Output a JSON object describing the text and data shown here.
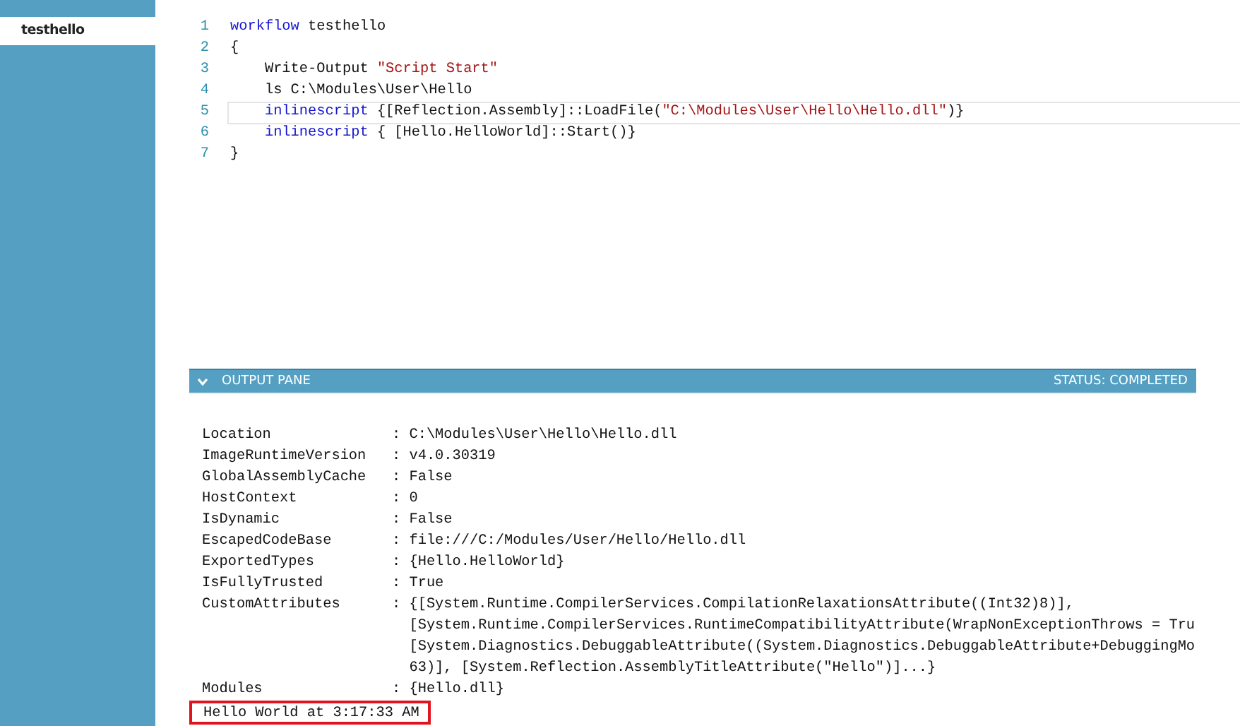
{
  "sidebar": {
    "items": [
      {
        "label": "testhello",
        "selected": true
      }
    ]
  },
  "editor": {
    "lines": [
      {
        "number": "1",
        "indented": false,
        "current": false,
        "tokens": [
          {
            "kind": "keyword",
            "text": "workflow"
          },
          {
            "kind": "plain",
            "text": " testhello"
          }
        ]
      },
      {
        "number": "2",
        "indented": false,
        "current": false,
        "tokens": [
          {
            "kind": "plain",
            "text": "{"
          }
        ]
      },
      {
        "number": "3",
        "indented": true,
        "current": false,
        "tokens": [
          {
            "kind": "plain",
            "text": "Write-Output "
          },
          {
            "kind": "string",
            "text": "\"Script Start\""
          }
        ]
      },
      {
        "number": "4",
        "indented": true,
        "current": false,
        "tokens": [
          {
            "kind": "plain",
            "text": "ls C:\\Modules\\User\\Hello"
          }
        ]
      },
      {
        "number": "5",
        "indented": true,
        "current": true,
        "tokens": [
          {
            "kind": "keyword",
            "text": "inlinescript"
          },
          {
            "kind": "plain",
            "text": " {[Reflection.Assembly]::LoadFile("
          },
          {
            "kind": "string",
            "text": "\"C:\\Modules\\User\\Hello\\Hello.dll\""
          },
          {
            "kind": "plain",
            "text": ")}"
          }
        ]
      },
      {
        "number": "6",
        "indented": true,
        "current": false,
        "tokens": [
          {
            "kind": "keyword",
            "text": "inlinescript"
          },
          {
            "kind": "plain",
            "text": " { [Hello.HelloWorld]::Start()}"
          }
        ]
      },
      {
        "number": "7",
        "indented": false,
        "current": false,
        "tokens": [
          {
            "kind": "plain",
            "text": "}"
          }
        ]
      }
    ]
  },
  "output_pane": {
    "title": "OUTPUT PANE",
    "status": "STATUS: COMPLETED",
    "expanded": true,
    "lines": [
      {
        "kind": "property",
        "name": "Location",
        "value": ": C:\\Modules\\User\\Hello\\Hello.dll"
      },
      {
        "kind": "property",
        "name": "ImageRuntimeVersion",
        "value": ": v4.0.30319"
      },
      {
        "kind": "property",
        "name": "GlobalAssemblyCache",
        "value": ": False"
      },
      {
        "kind": "property",
        "name": "HostContext",
        "value": ": 0"
      },
      {
        "kind": "property",
        "name": "IsDynamic",
        "value": ": False"
      },
      {
        "kind": "property",
        "name": "EscapedCodeBase",
        "value": ": file:///C:/Modules/User/Hello/Hello.dll"
      },
      {
        "kind": "property",
        "name": "ExportedTypes",
        "value": ": {Hello.HelloWorld}"
      },
      {
        "kind": "property",
        "name": "IsFullyTrusted",
        "value": ": True"
      },
      {
        "kind": "property",
        "name": "CustomAttributes",
        "value": ": {[System.Runtime.CompilerServices.CompilationRelaxationsAttribute((Int32)8)],"
      },
      {
        "kind": "continuation",
        "value": "[System.Runtime.CompilerServices.RuntimeCompatibilityAttribute(WrapNonExceptionThrows = Tru"
      },
      {
        "kind": "continuation",
        "value": "[System.Diagnostics.DebuggableAttribute((System.Diagnostics.DebuggableAttribute+DebuggingMo"
      },
      {
        "kind": "continuation",
        "value": "63)], [System.Reflection.AssemblyTitleAttribute(\"Hello\")]...}"
      },
      {
        "kind": "property",
        "name": "Modules",
        "value": ": {Hello.dll}"
      },
      {
        "kind": "message",
        "text": "Hello World at 3:17:33 AM",
        "highlighted": true
      }
    ]
  }
}
